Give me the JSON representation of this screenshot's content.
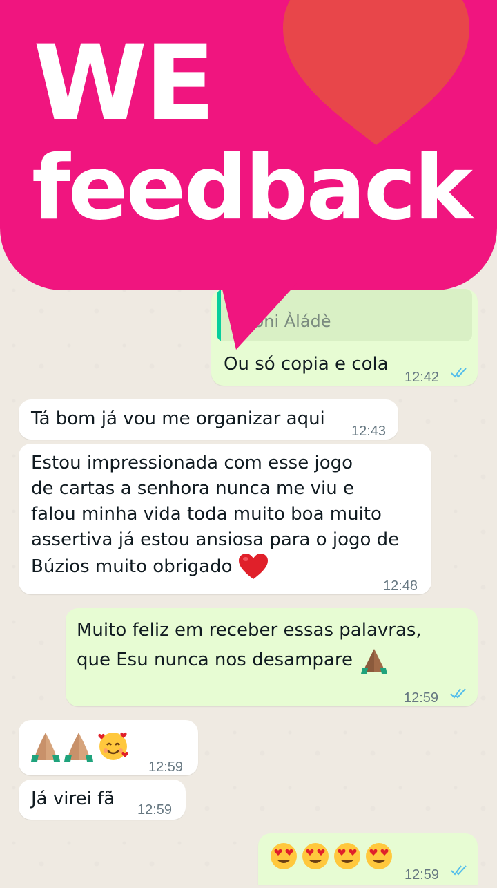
{
  "banner": {
    "line1": "WE",
    "line2": "feedback"
  },
  "messages": [
    {
      "quoted_name": "Oloni Àládè",
      "text": "Ou só copia e cola",
      "time": "12:42"
    },
    {
      "text": "Tá bom já vou me organizar aqui",
      "time": "12:43"
    },
    {
      "lines": [
        "Estou impressionada com esse jogo",
        "de cartas a senhora nunca me viu e",
        "falou minha vida toda muito boa muito",
        "assertiva já estou ansiosa para o jogo de",
        "Búzios muito obrigado"
      ],
      "emoji": "red-heart",
      "time": "12:48"
    },
    {
      "lines": [
        "Muito feliz em receber essas palavras,",
        "que Esu nunca nos desampare"
      ],
      "emoji": "folded-hands",
      "time": "12:59"
    },
    {
      "emojis": [
        "folded-hands",
        "folded-hands",
        "smiling-face-with-hearts"
      ],
      "time": "12:59"
    },
    {
      "text": "Já virei fã",
      "time": "12:59"
    },
    {
      "emojis": [
        "heart-eyes",
        "heart-eyes",
        "heart-eyes",
        "heart-eyes"
      ],
      "time": "12:59"
    }
  ],
  "colors": {
    "banner": "#f0157f",
    "outgoing_bubble": "#e7fcd3",
    "incoming_bubble": "#ffffff",
    "read_ticks": "#53bdeb"
  }
}
